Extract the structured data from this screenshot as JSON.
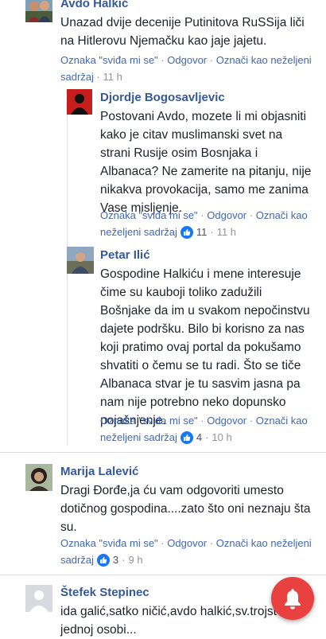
{
  "actions": {
    "like": "Oznaka \"sviđa mi se\"",
    "reply": "Odgovor",
    "mark_unwanted_1": "Označi kao neželjeni",
    "mark_unwanted_2": "sadržaj",
    "mark_unwanted_3": "neželjeni sadržaj",
    "sep": "·"
  },
  "comments": [
    {
      "author": "Avdo Halkić",
      "lines": [
        "Unazad dvije decenije Putinitova RuSSija liči",
        "na Hitlerovu Njemačku kao jaje jajetu."
      ],
      "time": "11 h",
      "avatar_icon": "profile-photo"
    },
    {
      "author": "Djordje Bogosavljevic",
      "lines": [
        "Postovani Avdo, mozete li mi objasniti",
        "kako je citav muslimanski svet na",
        "strani Rusije osim Bosnjaka i",
        "Albanaca? Ne zamerite na pitanju, nije",
        "nikakva provokacija, samo me zanima",
        "Vase misljenje."
      ],
      "likes": "11",
      "time": "11 h",
      "avatar_icon": "profile-photo-red"
    },
    {
      "author": "Petar Ilić",
      "lines": [
        "Gospodine Halkiću i mene interesuje",
        "čime su kauboji toliko zadužili",
        "Bošnjake da im u svakom nepočinstvu",
        "dajete podršku. Bilo bi korisno za nas",
        "koji pratimo ovaj portal da pokušamo",
        "shvatiti o čemu se tu radi. Što se tiče",
        "Albanaca stvar je tu sasvim jasna pa",
        "nam nije potrebno neko dopunsko",
        "pojašnjenje."
      ],
      "likes": "4",
      "time": "10 h",
      "avatar_icon": "profile-photo"
    },
    {
      "author": "Marija Lalević",
      "lines": [
        "Dragi Đorđe,ja ću vam odgovoriti umesto",
        "dotičnog gospodina....zato što oni neznaju šta",
        "su."
      ],
      "likes": "3",
      "time": "9 h",
      "avatar_icon": "profile-photo"
    },
    {
      "author": "Štefek Stepinec",
      "lines": [
        "ida galić,satko ničić,avdo halkić,sv.trojstvo u",
        "jednoj osobi..."
      ],
      "avatar_icon": "default-avatar"
    }
  ],
  "colors": {
    "link": "#365899",
    "action": "#4267b2",
    "meta": "#90949c",
    "like": "#1877f2",
    "notification": "#e8413f"
  }
}
